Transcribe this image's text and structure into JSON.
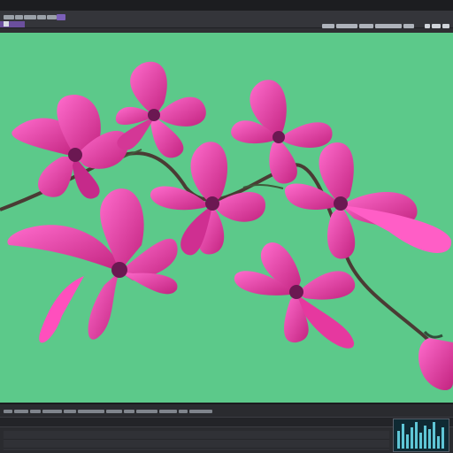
{
  "app": {
    "title_bar": "",
    "menu": {
      "status_text": ""
    }
  },
  "viewport": {
    "background": "#5cc98a",
    "subject": "pink-flowers-branch"
  },
  "timeline": {
    "label": ""
  },
  "colors": {
    "petal_dark": "#c8288a",
    "petal_light": "#ff4fc0",
    "branch": "#4a3b34",
    "background_green": "#5cc98a"
  }
}
